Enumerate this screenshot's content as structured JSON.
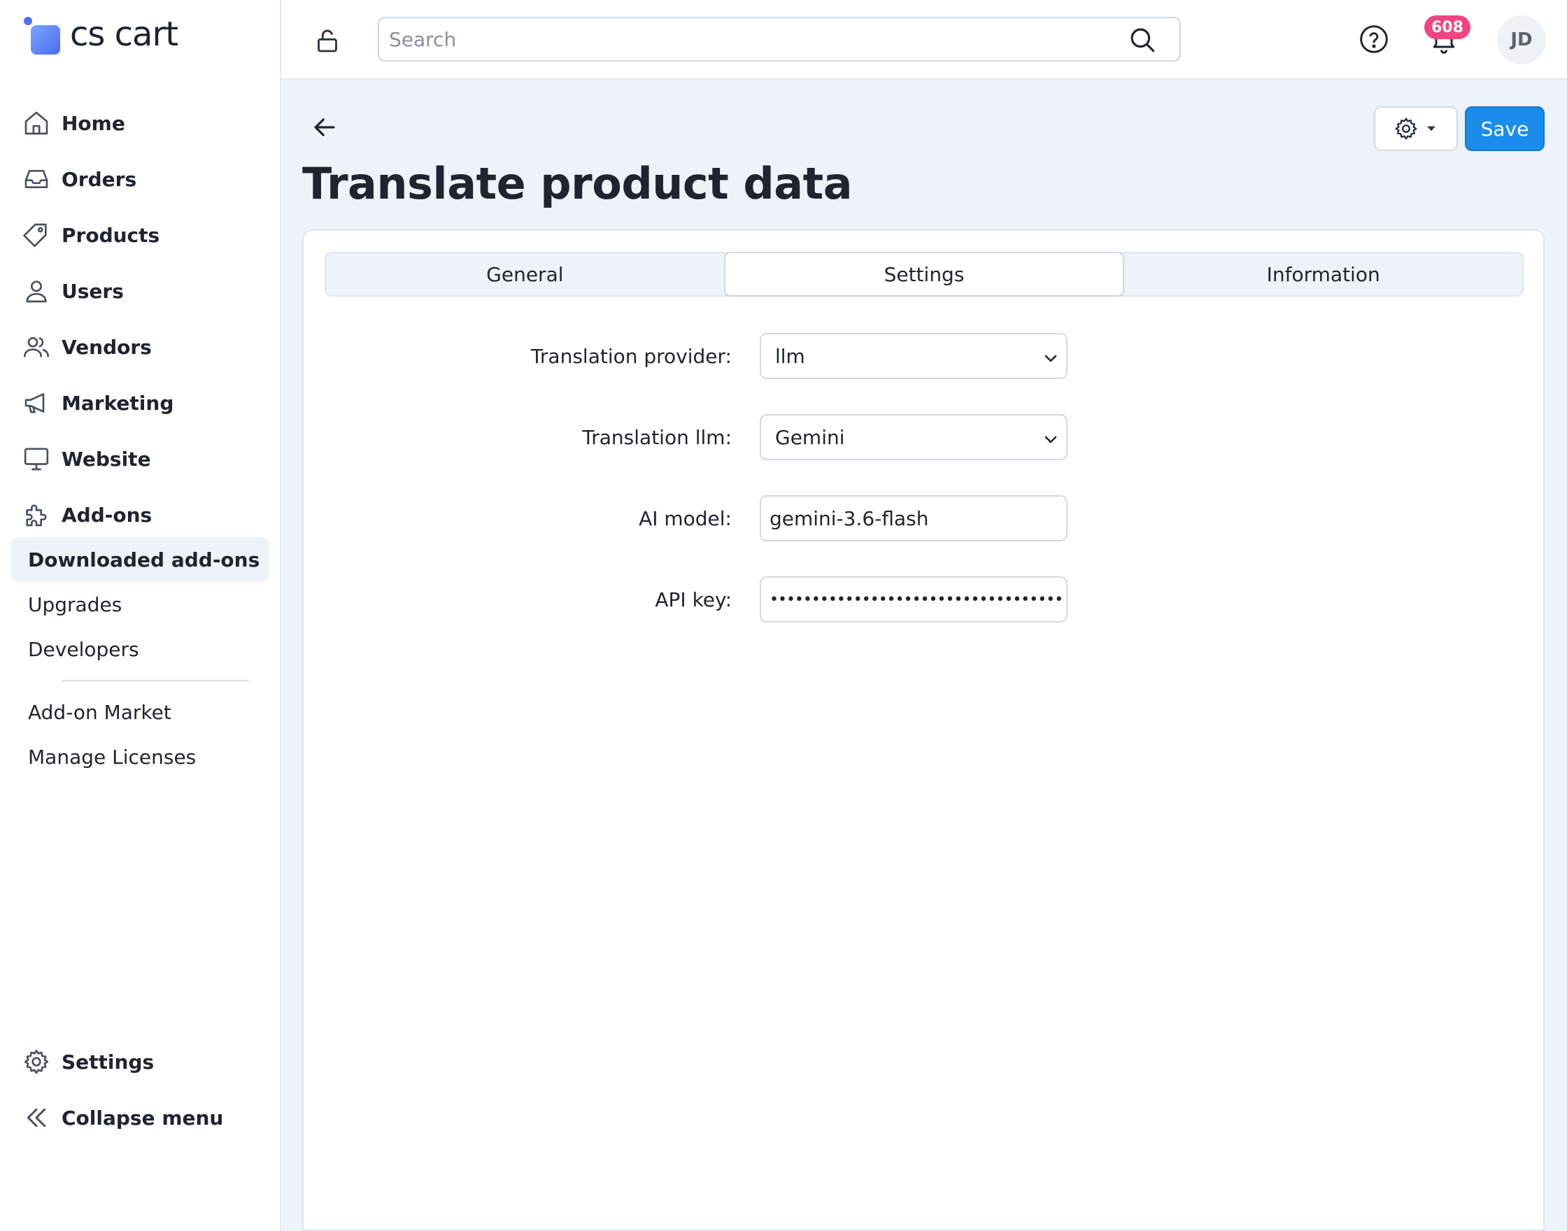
{
  "brand": {
    "name": "cs cart"
  },
  "sidebar": {
    "items": [
      {
        "label": "Home",
        "icon": "home-icon"
      },
      {
        "label": "Orders",
        "icon": "inbox-icon"
      },
      {
        "label": "Products",
        "icon": "tag-icon"
      },
      {
        "label": "Users",
        "icon": "user-icon"
      },
      {
        "label": "Vendors",
        "icon": "users-icon"
      },
      {
        "label": "Marketing",
        "icon": "megaphone-icon"
      },
      {
        "label": "Website",
        "icon": "monitor-icon"
      },
      {
        "label": "Add-ons",
        "icon": "puzzle-icon"
      }
    ],
    "sub_items": [
      {
        "label": "Downloaded add-ons",
        "active": true
      },
      {
        "label": "Upgrades"
      },
      {
        "label": "Developers"
      },
      {
        "label": "Add-on Market"
      },
      {
        "label": "Manage Licenses"
      }
    ],
    "settings_label": "Settings",
    "collapse_label": "Collapse menu"
  },
  "topbar": {
    "search_placeholder": "Search",
    "notification_count": "608",
    "avatar_initials": "JD"
  },
  "page": {
    "title": "Translate product data",
    "save_label": "Save",
    "tabs": [
      {
        "label": "General"
      },
      {
        "label": "Settings",
        "active": true
      },
      {
        "label": "Information"
      }
    ]
  },
  "form": {
    "provider": {
      "label": "Translation provider:",
      "value": "llm"
    },
    "llm": {
      "label": "Translation llm:",
      "value": "Gemini"
    },
    "model": {
      "label": "AI model:",
      "value": "gemini-3.6-flash"
    },
    "api_key": {
      "label": "API key:",
      "value": "••••••••••••••••••••••••••••••••••••••••"
    }
  },
  "colors": {
    "accent": "#1a8cec",
    "badge": "#f0457e",
    "background": "#eef2f9"
  }
}
